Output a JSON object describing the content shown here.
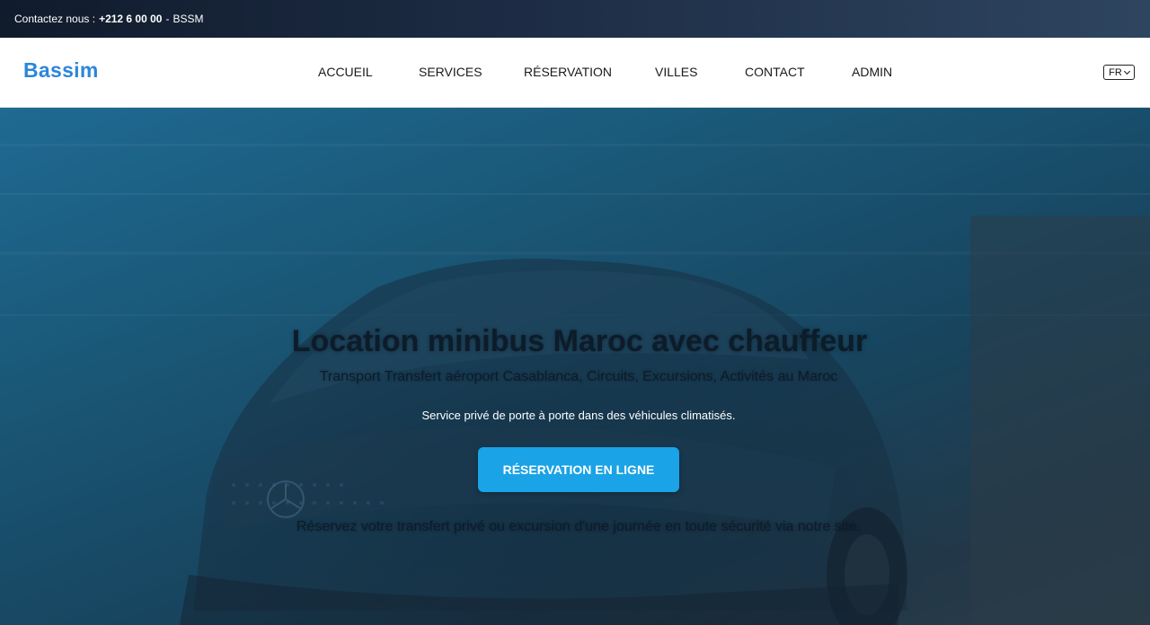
{
  "topbar": {
    "contact_label": "Contactez nous :",
    "phone": "+212 6 00 00",
    "separator": "-",
    "company": "BSSM"
  },
  "header": {
    "logo": "Bassim",
    "nav": [
      {
        "label": "ACCUEIL"
      },
      {
        "label": "SERVICES"
      },
      {
        "label": "RÉSERVATION"
      },
      {
        "label": "VILLES"
      },
      {
        "label": "CONTACT"
      },
      {
        "label": "ADMIN"
      }
    ],
    "language": "FR"
  },
  "hero": {
    "title": "Location minibus Maroc avec chauffeur",
    "subtitle": "Transport Transfert aéroport Casablanca, Circuits, Excursions, Activités au Maroc",
    "description": "Service privé de porte à porte dans des véhicules climatisés.",
    "cta_label": "RÉSERVATION EN LIGNE",
    "footer_text": "Réservez votre transfert privé ou excursion d'une journée en toute sécurité via notre site."
  },
  "colors": {
    "logo": "#2c86d9",
    "cta": "#1aa3e6",
    "topbar": "#101b2c",
    "hero_text": "#0d1c2a"
  }
}
